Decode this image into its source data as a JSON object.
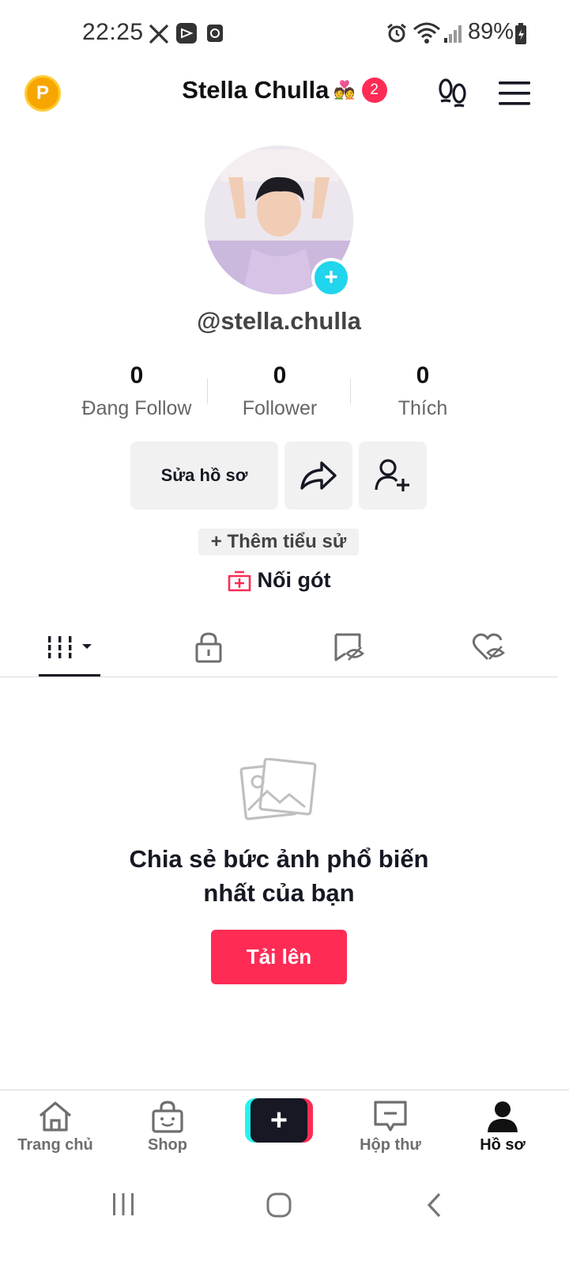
{
  "status_bar": {
    "time": "22:25",
    "battery": "89%"
  },
  "header": {
    "title": "Stella Chulla",
    "title_emoji": "💑",
    "notification_count": "2",
    "coin_letter": "P"
  },
  "profile": {
    "username": "@stella.chulla"
  },
  "stats": [
    {
      "value": "0",
      "label": "Đang Follow"
    },
    {
      "value": "0",
      "label": "Follower"
    },
    {
      "value": "0",
      "label": "Thích"
    }
  ],
  "actions": {
    "edit_profile": "Sửa hồ sơ",
    "add_bio": "+ Thêm tiểu sử",
    "link": "Nối gót"
  },
  "empty_state": {
    "line1": "Chia sẻ bức ảnh phổ biến",
    "line2": "nhất của bạn",
    "upload_button": "Tải lên"
  },
  "bottom_nav": [
    {
      "label": "Trang chủ"
    },
    {
      "label": "Shop"
    },
    {
      "label": "Hộp thư"
    },
    {
      "label": "Hồ sơ"
    }
  ],
  "colors": {
    "accent": "#fe2c55",
    "cyan": "#20d5ec",
    "text": "#161823"
  }
}
